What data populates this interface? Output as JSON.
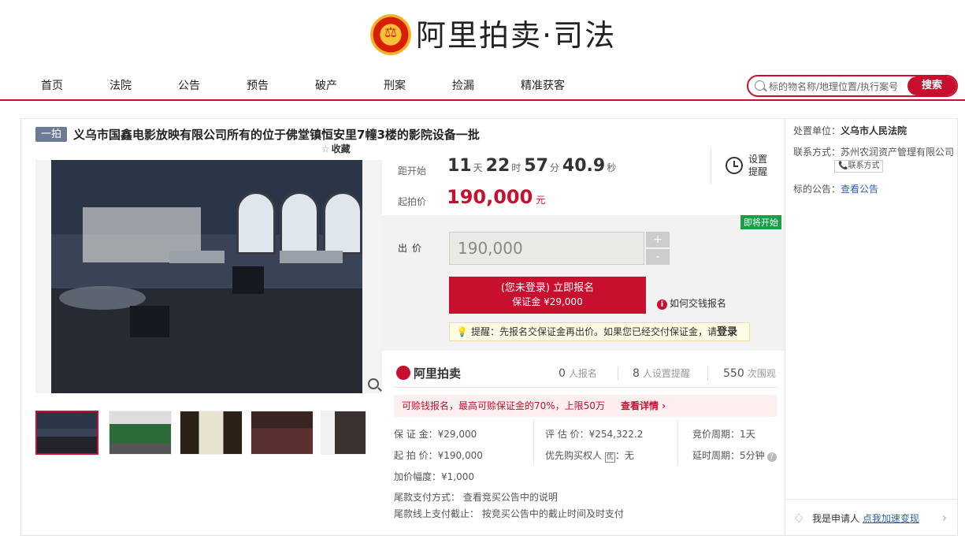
{
  "header": {
    "logo_text": "阿里拍卖·司法",
    "emblem_glyph": "⚖"
  },
  "nav": {
    "items": [
      "首页",
      "法院",
      "公告",
      "预告",
      "破产",
      "刑案",
      "捡漏",
      "精准获客"
    ],
    "search_placeholder": "标的物名称/地理位置/执行案号",
    "search_button": "搜索"
  },
  "item": {
    "tag": "一拍",
    "title": "义乌市国鑫电影放映有限公司所有的位于佛堂镇恒安里7幢3楼的影院设备一批",
    "favorite": "收藏"
  },
  "countdown": {
    "label": "距开始",
    "days": "11",
    "days_unit": "天",
    "hours": "22",
    "hours_unit": "时",
    "minutes": "57",
    "minutes_unit": "分",
    "seconds": "40.9",
    "seconds_unit": "秒"
  },
  "price": {
    "label": "起拍价",
    "value": "190,000",
    "unit": "元"
  },
  "remind": {
    "label": "设置提醒"
  },
  "bid": {
    "badge": "即将开始",
    "label": "出价",
    "value": "190,000",
    "plus": "+",
    "minus": "-",
    "enroll_line1": "(您未登录) 立即报名",
    "enroll_line2": "保证金 ¥29,000",
    "how_to_pay": "如何交钱报名",
    "tip": "提醒：先报名交保证金再出价。如果您已经交付保证金，请",
    "tip_login": "登录"
  },
  "stats": {
    "brand": "阿里拍卖",
    "enrolled_count": "0",
    "enrolled_label": "人报名",
    "reminders_count": "8",
    "reminders_label": "人设置提醒",
    "views_count": "550",
    "views_label": "次围观"
  },
  "promo": {
    "text": "可赊钱报名，最高可赊保证金的70%，上限50万",
    "link": "查看详情 ›"
  },
  "details": {
    "deposit": "保 证 金：¥29,000",
    "appraisal": "评 估 价：¥254,322.2",
    "period": "竞价周期：1天",
    "start_price": "起 拍 价：¥190,000",
    "priority_buyer": "优先购买权人",
    "priority_buyer_value": "：无",
    "priority_icon": "优",
    "extension": "延时周期：5分钟",
    "increment": "加价幅度：¥1,000",
    "payment_method": "尾款支付方式： 查看竞买公告中的说明",
    "payment_deadline": "尾款线上支付截止： 按竞买公告中的截止时间及时支付"
  },
  "right": {
    "court_label": "处置单位：",
    "court": "义乌市人民法院",
    "contact_label": "联系方式：",
    "contact": "苏州农润资产管理有限公司",
    "contact_button": "📞联系方式",
    "notice_label": "标的公告：",
    "notice_link": "查看公告",
    "applicant_text": "我是申请人 ",
    "applicant_link": "点我加速变现"
  }
}
